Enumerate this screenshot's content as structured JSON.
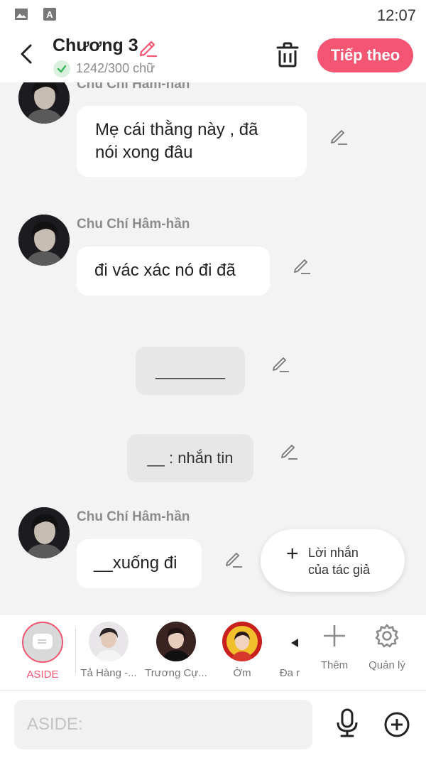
{
  "status_bar": {
    "time": "12:07"
  },
  "header": {
    "title": "Chương 3",
    "word_count": "1242/300 chữ",
    "next_button": "Tiếp theo"
  },
  "messages": [
    {
      "sender": "Chu Chí Hâm-hần",
      "text_line1": "Mẹ cái thằng này , đã",
      "text_line2": "nói xong đâu"
    },
    {
      "sender": "Chu Chí Hâm-hần",
      "text": "đi vác xác nó đi đã"
    },
    {
      "narration": "________"
    },
    {
      "narration": "__ : nhắn tin"
    },
    {
      "sender": "Chu Chí Hâm-hần",
      "text": "__xuống đi"
    }
  ],
  "fab": {
    "line1": "Lời nhắn",
    "line2": "của tác giả"
  },
  "characters": [
    {
      "name": "ASIDE",
      "color": "#f45572"
    },
    {
      "name": "Tả Hàng -..."
    },
    {
      "name": "Trương Cự..."
    },
    {
      "name": "Ờm"
    },
    {
      "name": "Đa r"
    }
  ],
  "tools": {
    "add": "Thêm",
    "manage": "Quản lý"
  },
  "input": {
    "placeholder": "ASIDE:"
  },
  "colors": {
    "accent": "#f45572",
    "check": "#3bb55a"
  }
}
